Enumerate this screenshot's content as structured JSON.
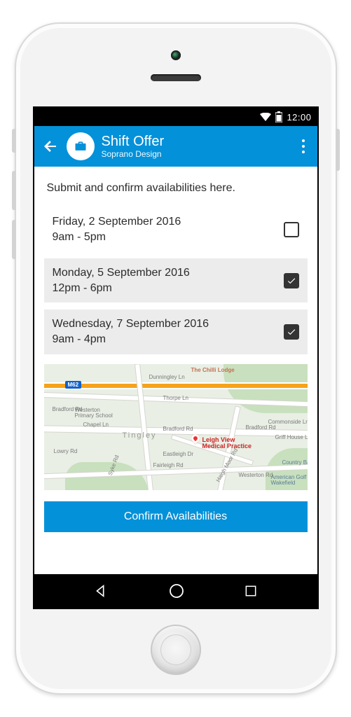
{
  "status_bar": {
    "time": "12:00"
  },
  "header": {
    "title": "Shift Offer",
    "subtitle": "Soprano Design"
  },
  "intro": "Submit and confirm availabilities here.",
  "shifts": [
    {
      "date": "Friday, 2 September 2016",
      "time": "9am - 5pm",
      "checked": false
    },
    {
      "date": "Monday, 5 September 2016",
      "time": "12pm - 6pm",
      "checked": true
    },
    {
      "date": "Wednesday, 7 September 2016",
      "time": "9am - 4pm",
      "checked": true
    }
  ],
  "map": {
    "motorway_badge": "M62",
    "pin_label_line1": "Leigh View",
    "pin_label_line2": "Medical Practice",
    "labels": {
      "chilli": "The Chilli Lodge",
      "dunningley": "Dunningley Ln",
      "thorpe": "Thorpe Ln",
      "bradford1": "Bradford Rd",
      "bradford2": "Bradford Rd",
      "bradford3": "Bradford Rd",
      "chapel": "Chapel Ln",
      "tingley": "Tingley",
      "primary": "Westerton\nPrimary School",
      "lowry": "Lowry Rd",
      "syke": "Syke Rd",
      "eastleigh": "Eastleigh Dr",
      "fairleigh": "Fairleigh Rd",
      "haigh": "Haigh Moor Rd",
      "westerton": "Westerton Rd",
      "commonside": "Commonside Ln",
      "griff": "Griff House Ln",
      "country": "Country Baske",
      "golf": "American Golf\nWakefield"
    }
  },
  "confirm_label": "Confirm Availabilities"
}
